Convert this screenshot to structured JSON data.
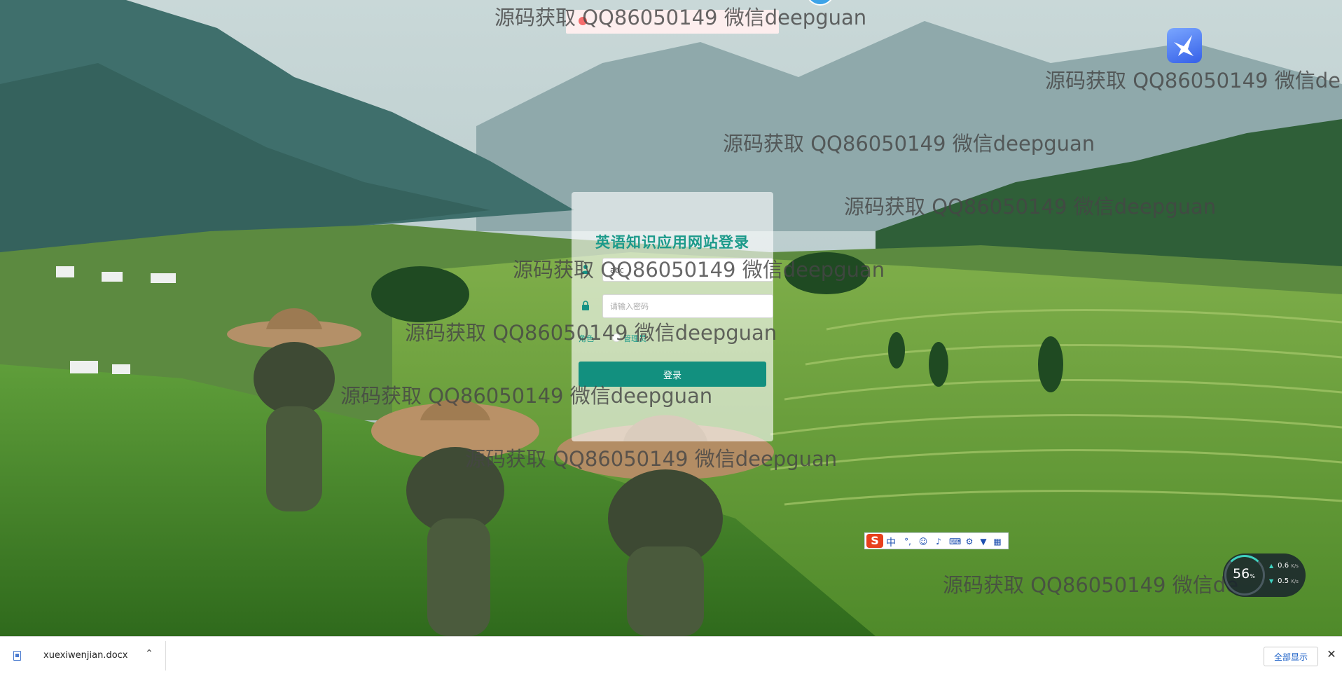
{
  "login": {
    "title": "英语知识应用网站登录",
    "username_value": "abc",
    "password_placeholder": "请输入密码",
    "role_label": "角色",
    "role_option": "管理员",
    "submit_label": "登录"
  },
  "watermark": {
    "text": "源码获取 QQ86050149 微信deepguan",
    "text_clipped": "源码获取 QQ86050149 微信de"
  },
  "ime": {
    "brand_letter": "S",
    "mode": "中"
  },
  "net_widget": {
    "percent": "56",
    "percent_unit": "%",
    "up_value": "0.6",
    "down_value": "0.5",
    "unit": "K/s"
  },
  "download_bar": {
    "file_name": "xuexiwenjian.docx",
    "show_all_label": "全部显示"
  },
  "colors": {
    "accent": "#12907f",
    "title": "#1c9a8a",
    "error": "#f56c6c"
  }
}
